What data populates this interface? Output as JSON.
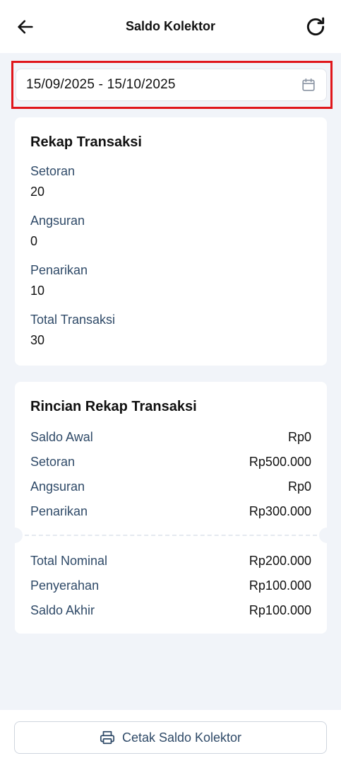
{
  "header": {
    "title": "Saldo Kolektor",
    "back_icon": "arrow-left-icon",
    "refresh_icon": "refresh-icon"
  },
  "date_range": {
    "value": "15/09/2025 - 15/10/2025",
    "icon": "calendar-icon",
    "highlight_color": "#e0161b"
  },
  "rekap": {
    "title": "Rekap Transaksi",
    "items": [
      {
        "label": "Setoran",
        "value": "20"
      },
      {
        "label": "Angsuran",
        "value": "0"
      },
      {
        "label": "Penarikan",
        "value": "10"
      },
      {
        "label": "Total Transaksi",
        "value": "30"
      }
    ]
  },
  "rincian": {
    "title": "Rincian Rekap Transaksi",
    "rows_top": [
      {
        "label": "Saldo Awal",
        "amount": "Rp0"
      },
      {
        "label": "Setoran",
        "amount": "Rp500.000"
      },
      {
        "label": "Angsuran",
        "amount": "Rp0"
      },
      {
        "label": "Penarikan",
        "amount": "Rp300.000"
      }
    ],
    "rows_bottom": [
      {
        "label": "Total Nominal",
        "amount": "Rp200.000"
      },
      {
        "label": "Penyerahan",
        "amount": "Rp100.000"
      },
      {
        "label": "Saldo Akhir",
        "amount": "Rp100.000"
      }
    ]
  },
  "footer": {
    "print_label": "Cetak Saldo Kolektor",
    "print_icon": "printer-icon"
  },
  "colors": {
    "background": "#f1f4f9",
    "label": "#2f4a68",
    "text": "#111111"
  }
}
